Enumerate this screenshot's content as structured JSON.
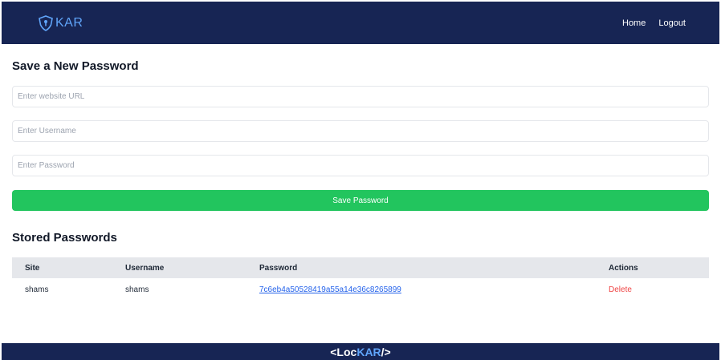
{
  "navbar": {
    "logo_text": "KAR",
    "logo_icon": "shield-keyhole-icon",
    "links": [
      "Home",
      "Logout"
    ]
  },
  "form": {
    "title": "Save a New Password",
    "url_placeholder": "Enter website URL",
    "username_placeholder": "Enter Username",
    "password_placeholder": "Enter Password",
    "save_label": "Save Password"
  },
  "stored": {
    "title": "Stored Passwords",
    "columns": [
      "Site",
      "Username",
      "Password",
      "Actions"
    ],
    "rows": [
      {
        "site": "shams",
        "username": "shams",
        "password": "7c6eb4a50528419a55a14e36c8265899",
        "action": "Delete"
      }
    ]
  },
  "footer": {
    "prefix": "<Loc",
    "accent": "KAR",
    "suffix": "/>"
  },
  "colors": {
    "navbar_bg": "#172554",
    "accent_blue": "#60a5fa",
    "save_green": "#22c55e",
    "delete_red": "#ef4444",
    "link_blue": "#2563eb"
  }
}
